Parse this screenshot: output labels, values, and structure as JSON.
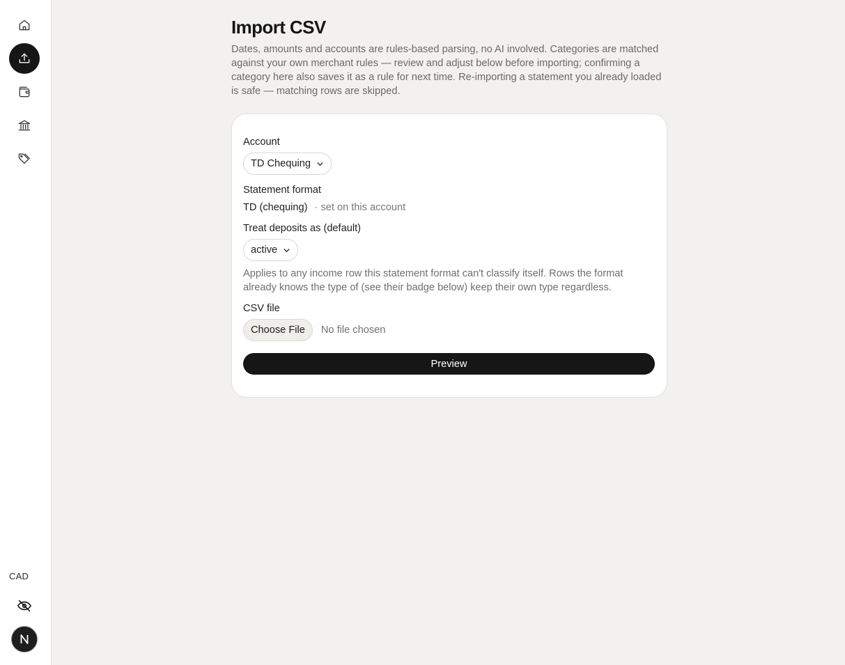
{
  "sidebar": {
    "nav": [
      {
        "icon": "home-icon",
        "active": false
      },
      {
        "icon": "upload-icon",
        "active": true
      },
      {
        "icon": "wallet-icon",
        "active": false
      },
      {
        "icon": "bank-icon",
        "active": false
      },
      {
        "icon": "tags-icon",
        "active": false
      }
    ],
    "currency": "CAD",
    "privacy_icon": "eye-off-icon",
    "avatar_icon": "user-initial-icon"
  },
  "page": {
    "title": "Import CSV",
    "intro": "Dates, amounts and accounts are rules-based parsing, no AI involved. Categories are matched against your own merchant rules — review and adjust below before importing; confirming a category here also saves it as a rule for next time. Re-importing a statement you already loaded is safe — matching rows are skipped."
  },
  "form": {
    "account_label": "Account",
    "account_value": "TD Chequing",
    "format_label": "Statement format",
    "format_value": "TD (chequing)",
    "format_note": "· set on this account",
    "deposits_label": "Treat deposits as (default)",
    "deposits_value": "active",
    "deposits_help": "Applies to any income row this statement format can't classify itself. Rows the format already knows the type of (see their badge below) keep their own type regardless.",
    "file_label": "CSV file",
    "file_button": "Choose File",
    "file_status": "No file chosen",
    "preview_button": "Preview"
  },
  "colors": {
    "background": "#f2f1ef",
    "accent": "#161616",
    "card": "#ffffff"
  }
}
